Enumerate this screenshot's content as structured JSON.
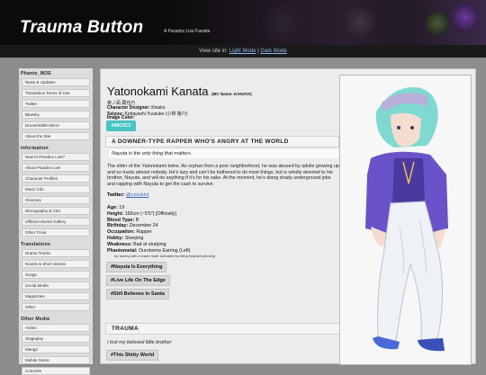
{
  "site": {
    "title": "Trauma Button",
    "subtitle": "A Paradox Live Fansite",
    "view_prefix": "View site in: ",
    "view_light": "Light Mode",
    "view_sep": " | ",
    "view_dark": "Dark Mode"
  },
  "sidebar": {
    "sections": [
      {
        "title": "Phanto_MOE",
        "items": [
          "News & Updates",
          "Translation Terms of Use",
          "Twitter",
          "Bluesky",
          "DreamWidth Mirror",
          "About the Site"
        ]
      },
      {
        "title": "Information",
        "items": [
          "New to Paradox Live?",
          "About Paradox Live",
          "Character Profiles",
          "Music Info",
          "Glossary",
          "Discography & CDs",
          "Official Artwork Gallery",
          "Other Trivia"
        ]
      },
      {
        "title": "Translations",
        "items": [
          "Drama Tracks",
          "Novels & Short Stories",
          "Songs",
          "Social Media",
          "Magazines",
          "Other"
        ]
      },
      {
        "title": "Other Media",
        "items": [
          "Anime",
          "Stageplay",
          "Manga",
          "Mobile Game",
          "Concerts"
        ]
      }
    ]
  },
  "profile": {
    "name": "Yatonokami Kanata",
    "mc_name": "(MC Name: KANATA)",
    "kanji": "夜ノ凪 蔵也乃",
    "designer_label": "Character Designer:",
    "designer": "Kinako",
    "seiyuu_label": "Seiyuu:",
    "seiyuu": "Kobayashi Yuusuke (小林 裕介)",
    "image_color_label": "Image Color:",
    "color": "#46C3C3",
    "section1": "A DOWNER-TYPE RAPPER WHO'S ANGRY AT THE WORLD",
    "quote": "Nayuta is the only thing that matters.",
    "bio": "The elder of the Yatonokami twins. An orphan from a poor neighborhood, he was abused by adults growing up and so trusts almost nobody. He's lazy and can't be bothered to do most things, but is wholly devoted to his brother, Nayuta, and will do anything if it's for his sake. At the moment, he's doing shady underground jobs and rapping with Nayuta to get the cash to survive.",
    "twitter_label": "Twitter:",
    "twitter": "@cznzkint",
    "stats": [
      {
        "label": "Age:",
        "value": "19"
      },
      {
        "label": "Height:",
        "value": "165cm (~5'5\") [Officially]"
      },
      {
        "label": "Blood Type:",
        "value": "B"
      },
      {
        "label": "Birthday:",
        "value": "December 24"
      },
      {
        "label": "Occupation:",
        "value": "Rapper"
      },
      {
        "label": "Hobby:",
        "value": "Sleeping"
      },
      {
        "label": "Weakness:",
        "value": "Bad at studying"
      },
      {
        "label": "Phantometal:",
        "value": "Ouroboros Earring (Left)"
      }
    ],
    "phantometal_note": "An earring with a snake motif. Activated by biting Nayuta's piercing",
    "tags": [
      "#Nayuta Is Everything",
      "#Live Life On The Edge",
      "#Still Believes in Santa"
    ],
    "section2": "TRAUMA",
    "trauma_quote": "I lost my beloved little brother",
    "trauma_tag": "#This Shitty World"
  }
}
